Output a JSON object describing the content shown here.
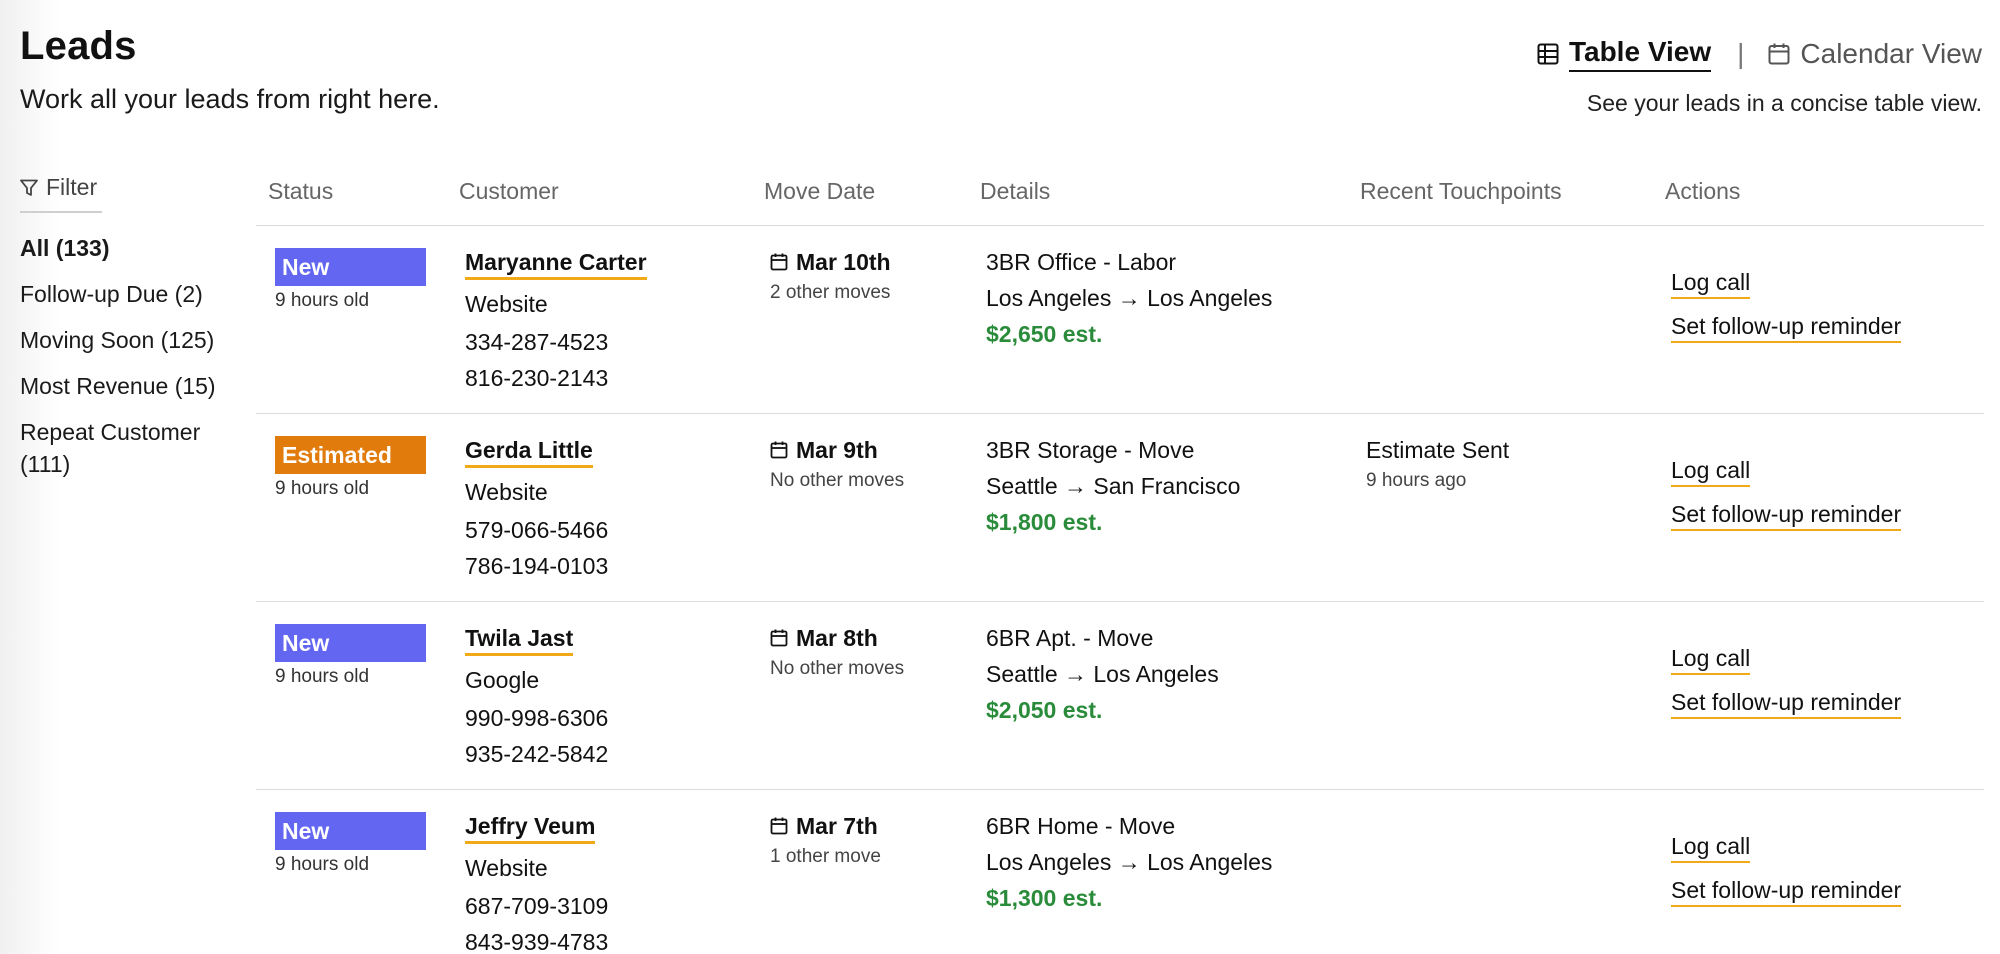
{
  "header": {
    "title": "Leads",
    "subtitle": "Work all your leads from right here.",
    "views": {
      "table": "Table View",
      "calendar": "Calendar View"
    },
    "view_description": "See your leads in a concise table view."
  },
  "filter": {
    "label": "Filter",
    "items": [
      {
        "label": "All (133)",
        "active": true
      },
      {
        "label": "Follow-up Due (2)"
      },
      {
        "label": "Moving Soon (125)"
      },
      {
        "label": "Most Revenue (15)"
      },
      {
        "label": "Repeat Customer (111)"
      }
    ]
  },
  "columns": [
    "Status",
    "Customer",
    "Move Date",
    "Details",
    "Recent Touchpoints",
    "Actions"
  ],
  "status_colors": {
    "New": "#6366f1",
    "Estimated": "#e07b0c"
  },
  "price_color": "#2a8c3a",
  "leads": [
    {
      "status": "New",
      "age": "9 hours old",
      "name": "Maryanne Carter",
      "source": "Website",
      "phone1": "334-287-4523",
      "phone2": "816-230-2143",
      "date": "Mar 10th",
      "date_sub": "2 other moves",
      "detail": "3BR Office - Labor",
      "route": "Los Angeles → Los Angeles",
      "price": "$2,650 est.",
      "touch": "",
      "touch_sub": "",
      "action1": "Log call",
      "action2": "Set follow-up reminder"
    },
    {
      "status": "Estimated",
      "age": "9 hours old",
      "name": "Gerda Little",
      "source": "Website",
      "phone1": "579-066-5466",
      "phone2": "786-194-0103",
      "date": "Mar 9th",
      "date_sub": "No other moves",
      "detail": "3BR Storage - Move",
      "route": "Seattle → San Francisco",
      "price": "$1,800 est.",
      "touch": "Estimate Sent",
      "touch_sub": "9 hours ago",
      "action1": "Log call",
      "action2": "Set follow-up reminder"
    },
    {
      "status": "New",
      "age": "9 hours old",
      "name": "Twila Jast",
      "source": "Google",
      "phone1": "990-998-6306",
      "phone2": "935-242-5842",
      "date": "Mar 8th",
      "date_sub": "No other moves",
      "detail": "6BR Apt. - Move",
      "route": "Seattle → Los Angeles",
      "price": "$2,050 est.",
      "touch": "",
      "touch_sub": "",
      "action1": "Log call",
      "action2": "Set follow-up reminder"
    },
    {
      "status": "New",
      "age": "9 hours old",
      "name": "Jeffry Veum",
      "source": "Website",
      "phone1": "687-709-3109",
      "phone2": "843-939-4783",
      "date": "Mar 7th",
      "date_sub": "1 other move",
      "detail": "6BR Home - Move",
      "route": "Los Angeles → Los Angeles",
      "price": "$1,300 est.",
      "touch": "",
      "touch_sub": "",
      "action1": "Log call",
      "action2": "Set follow-up reminder"
    }
  ]
}
